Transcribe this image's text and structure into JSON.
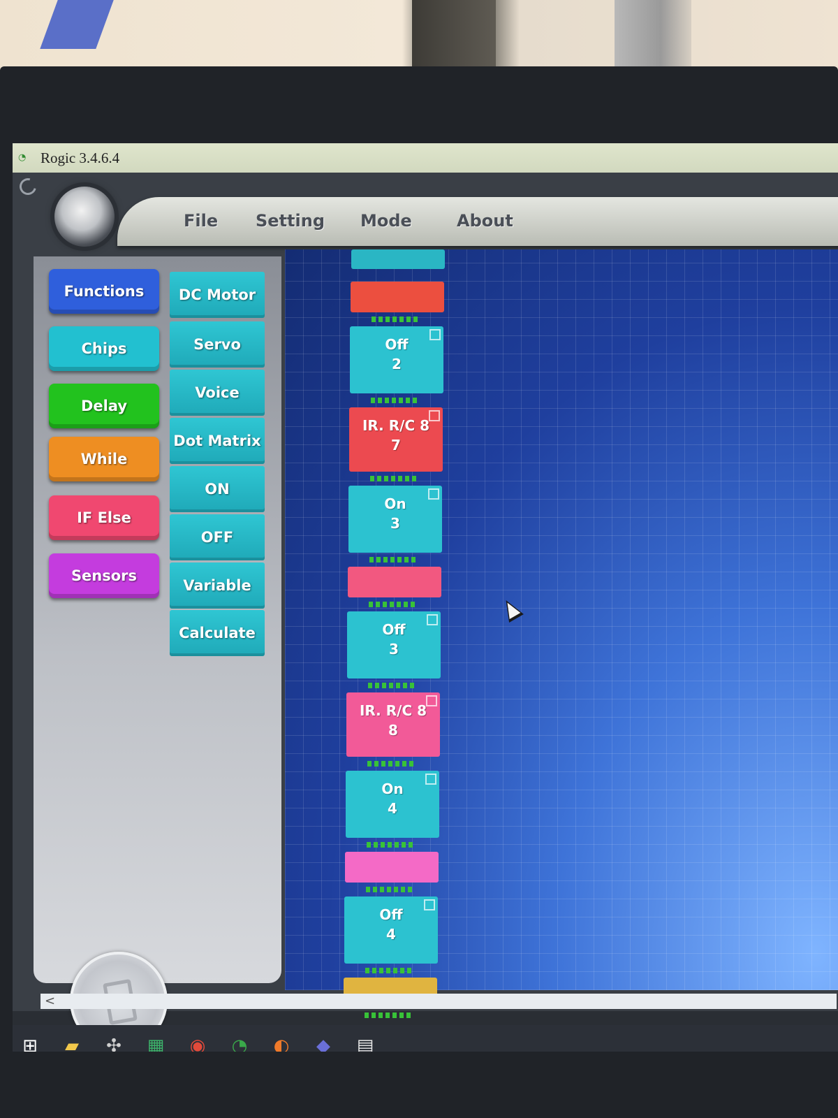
{
  "window": {
    "title": "Rogic 3.4.6.4"
  },
  "menu": [
    "File",
    "Setting",
    "Mode",
    "About"
  ],
  "categories": [
    {
      "label": "Functions",
      "color": "#2f5fdc"
    },
    {
      "label": "Chips",
      "color": "#22c0d0"
    },
    {
      "label": "Delay",
      "color": "#22c21e"
    },
    {
      "label": "While",
      "color": "#ee8e22"
    },
    {
      "label": "IF Else",
      "color": "#f04870"
    },
    {
      "label": "Sensors",
      "color": "#c43cde"
    }
  ],
  "chips": [
    "DC Motor",
    "Servo",
    "Voice",
    "Dot Matrix",
    "ON",
    "OFF",
    "Variable",
    "Calculate"
  ],
  "program_blocks": [
    {
      "kind": "cap",
      "color": "#2ab6c4"
    },
    {
      "kind": "bar",
      "color": "#ec4f3f"
    },
    {
      "kind": "chip",
      "label": "Off",
      "num": "2",
      "color": "#2cc2d0"
    },
    {
      "kind": "sensor",
      "label": "IR. R/C 8",
      "num": "7",
      "color": "#ec4a50"
    },
    {
      "kind": "chip",
      "label": "On",
      "num": "3",
      "color": "#2cc2d0"
    },
    {
      "kind": "bar",
      "color": "#f25880"
    },
    {
      "kind": "chip",
      "label": "Off",
      "num": "3",
      "color": "#2cc2d0"
    },
    {
      "kind": "sensor",
      "label": "IR. R/C 8",
      "num": "8",
      "color": "#f25a98"
    },
    {
      "kind": "chip",
      "label": "On",
      "num": "4",
      "color": "#2cc2d0"
    },
    {
      "kind": "bar",
      "color": "#f46ac6"
    },
    {
      "kind": "chip",
      "label": "Off",
      "num": "4",
      "color": "#2cc2d0"
    },
    {
      "kind": "bar",
      "color": "#e0b440"
    }
  ],
  "taskbar": [
    "windows-start",
    "file-explorer",
    "app-mixer",
    "spreadsheet",
    "chrome",
    "rogic",
    "firefox",
    "teams",
    "document"
  ]
}
